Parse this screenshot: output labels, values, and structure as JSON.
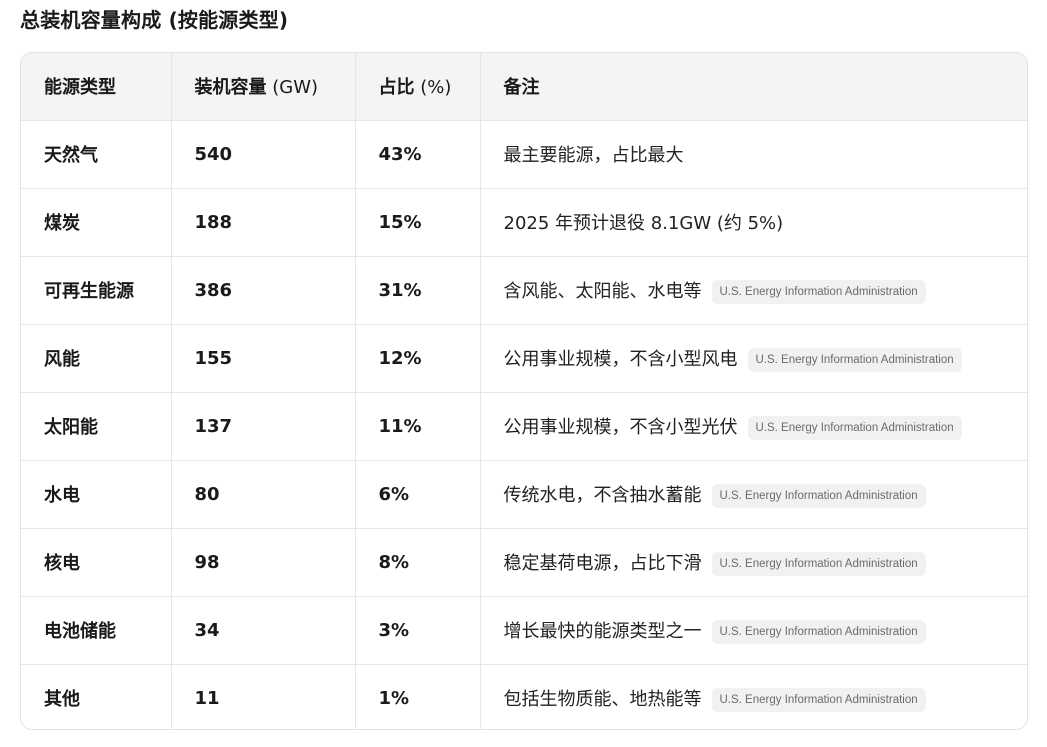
{
  "page": {
    "title": "总装机容量构成 (按能源类型)"
  },
  "table": {
    "headers": {
      "type": "能源类型",
      "capacity": "装机容量",
      "capacity_unit": " (GW)",
      "share": "占比",
      "share_unit": " (%)",
      "note": "备注"
    },
    "rows": [
      {
        "type": "天然气",
        "capacity": "540",
        "share": "43%",
        "note": "最主要能源，占比最大",
        "source": ""
      },
      {
        "type": "煤炭",
        "capacity": "188",
        "share": "15%",
        "note": "2025 年预计退役 8.1GW (约 5%)",
        "source": ""
      },
      {
        "type": "可再生能源",
        "capacity": "386",
        "share": "31%",
        "note": "含风能、太阳能、水电等",
        "source": "U.S. Energy Information Administration"
      },
      {
        "type": "风能",
        "capacity": "155",
        "share": "12%",
        "note": "公用事业规模，不含小型风电",
        "source": "U.S. Energy Information Administration"
      },
      {
        "type": "太阳能",
        "capacity": "137",
        "share": "11%",
        "note": "公用事业规模，不含小型光伏",
        "source": "U.S. Energy Information Administration"
      },
      {
        "type": "水电",
        "capacity": "80",
        "share": "6%",
        "note": "传统水电，不含抽水蓄能",
        "source": "U.S. Energy Information Administration"
      },
      {
        "type": "核电",
        "capacity": "98",
        "share": "8%",
        "note": "稳定基荷电源，占比下滑",
        "source": "U.S. Energy Information Administration"
      },
      {
        "type": "电池储能",
        "capacity": "34",
        "share": "3%",
        "note": "增长最快的能源类型之一",
        "source": "U.S. Energy Information Administration"
      },
      {
        "type": "其他",
        "capacity": "11",
        "share": "1%",
        "note": "包括生物质能、地热能等",
        "source": "U.S. Energy Information Administration"
      }
    ]
  }
}
